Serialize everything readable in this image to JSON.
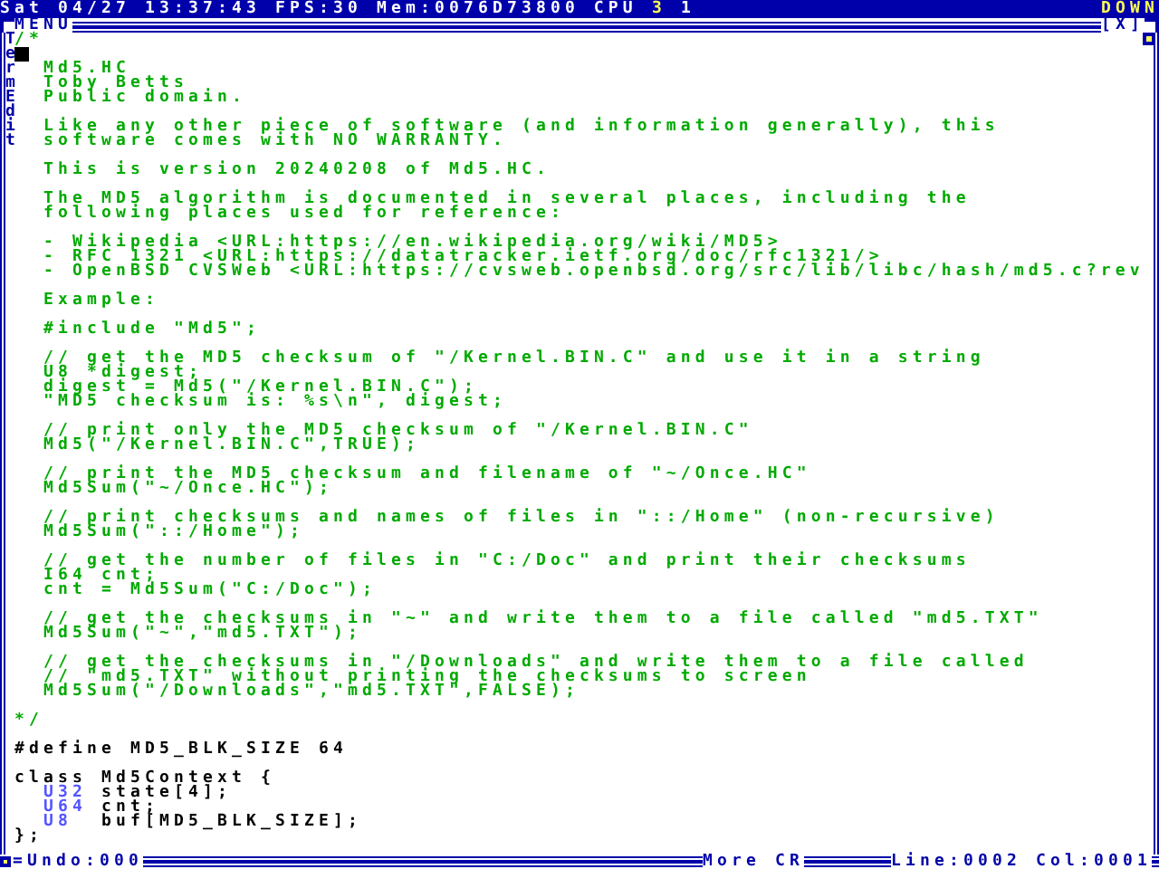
{
  "top_bar": {
    "status": "Sat 04/27 13:37:43 FPS:30 Mem:0076D73800 CPU",
    "cpus": [
      {
        "label": "3",
        "highlighted": true
      },
      {
        "label": "1",
        "highlighted": false
      }
    ],
    "scroll_hint": "DOWN"
  },
  "window": {
    "menu": "MENU",
    "close": "[X]",
    "side_labels": [
      "Term",
      "Edit"
    ],
    "lines": [
      {
        "kind": "comment",
        "segments": [
          {
            "text": "/*",
            "kind": "comment"
          }
        ]
      },
      {
        "kind": "cursor"
      },
      {
        "kind": "text",
        "segments": [
          {
            "text": "  Md5.HC",
            "kind": "comment"
          }
        ]
      },
      {
        "kind": "text",
        "segments": [
          {
            "text": "  Toby Betts",
            "kind": "comment"
          }
        ]
      },
      {
        "kind": "text",
        "segments": [
          {
            "text": "  Public domain.",
            "kind": "comment"
          }
        ]
      },
      {
        "kind": "blank"
      },
      {
        "kind": "text",
        "segments": [
          {
            "text": "  Like any other piece of software (and information generally), this",
            "kind": "comment"
          }
        ]
      },
      {
        "kind": "text",
        "segments": [
          {
            "text": "  software comes with NO WARRANTY.",
            "kind": "comment"
          }
        ]
      },
      {
        "kind": "blank"
      },
      {
        "kind": "text",
        "segments": [
          {
            "text": "  This is version 20240208 of Md5.HC.",
            "kind": "comment"
          }
        ]
      },
      {
        "kind": "blank"
      },
      {
        "kind": "text",
        "segments": [
          {
            "text": "  The MD5 algorithm is documented in several places, including the",
            "kind": "comment"
          }
        ]
      },
      {
        "kind": "text",
        "segments": [
          {
            "text": "  following places used for reference:",
            "kind": "comment"
          }
        ]
      },
      {
        "kind": "blank"
      },
      {
        "kind": "text",
        "segments": [
          {
            "text": "  - Wikipedia <URL:https://en.wikipedia.org/wiki/MD5>",
            "kind": "comment"
          }
        ]
      },
      {
        "kind": "text",
        "segments": [
          {
            "text": "  - RFC 1321 <URL:https://datatracker.ietf.org/doc/rfc1321/>",
            "kind": "comment"
          }
        ]
      },
      {
        "kind": "text",
        "segments": [
          {
            "text": "  - OpenBSD CVSWeb <URL:https://cvsweb.openbsd.org/src/lib/libc/hash/md5.c?rev",
            "kind": "comment"
          }
        ]
      },
      {
        "kind": "blank"
      },
      {
        "kind": "text",
        "segments": [
          {
            "text": "  Example:",
            "kind": "comment"
          }
        ]
      },
      {
        "kind": "blank"
      },
      {
        "kind": "text",
        "segments": [
          {
            "text": "  #include \"Md5\";",
            "kind": "comment"
          }
        ]
      },
      {
        "kind": "blank"
      },
      {
        "kind": "text",
        "segments": [
          {
            "text": "  // get the MD5 checksum of \"/Kernel.BIN.C\" and use it in a string",
            "kind": "comment"
          }
        ]
      },
      {
        "kind": "text",
        "segments": [
          {
            "text": "  U8 *digest;",
            "kind": "comment"
          }
        ]
      },
      {
        "kind": "text",
        "segments": [
          {
            "text": "  digest = Md5(\"/Kernel.BIN.C\");",
            "kind": "comment"
          }
        ]
      },
      {
        "kind": "text",
        "segments": [
          {
            "text": "  \"MD5 checksum is: %s\\n\", digest;",
            "kind": "comment"
          }
        ]
      },
      {
        "kind": "blank"
      },
      {
        "kind": "text",
        "segments": [
          {
            "text": "  // print only the MD5 checksum of \"/Kernel.BIN.C\"",
            "kind": "comment"
          }
        ]
      },
      {
        "kind": "text",
        "segments": [
          {
            "text": "  Md5(\"/Kernel.BIN.C\",TRUE);",
            "kind": "comment"
          }
        ]
      },
      {
        "kind": "blank"
      },
      {
        "kind": "text",
        "segments": [
          {
            "text": "  // print the MD5 checksum and filename of \"~/Once.HC\"",
            "kind": "comment"
          }
        ]
      },
      {
        "kind": "text",
        "segments": [
          {
            "text": "  Md5Sum(\"~/Once.HC\");",
            "kind": "comment"
          }
        ]
      },
      {
        "kind": "blank"
      },
      {
        "kind": "text",
        "segments": [
          {
            "text": "  // print checksums and names of files in \"::/Home\" (non-recursive)",
            "kind": "comment"
          }
        ]
      },
      {
        "kind": "text",
        "segments": [
          {
            "text": "  Md5Sum(\"::/Home\");",
            "kind": "comment"
          }
        ]
      },
      {
        "kind": "blank"
      },
      {
        "kind": "text",
        "segments": [
          {
            "text": "  // get the number of files in \"C:/Doc\" and print their checksums",
            "kind": "comment"
          }
        ]
      },
      {
        "kind": "text",
        "segments": [
          {
            "text": "  I64 cnt;",
            "kind": "comment"
          }
        ]
      },
      {
        "kind": "text",
        "segments": [
          {
            "text": "  cnt = Md5Sum(\"C:/Doc\");",
            "kind": "comment"
          }
        ]
      },
      {
        "kind": "blank"
      },
      {
        "kind": "text",
        "segments": [
          {
            "text": "  // get the checksums in \"~\" and write them to a file called \"md5.TXT\"",
            "kind": "comment"
          }
        ]
      },
      {
        "kind": "text",
        "segments": [
          {
            "text": "  Md5Sum(\"~\",\"md5.TXT\");",
            "kind": "comment"
          }
        ]
      },
      {
        "kind": "blank"
      },
      {
        "kind": "text",
        "segments": [
          {
            "text": "  // get the checksums in \"/Downloads\" and write them to a file called",
            "kind": "comment"
          }
        ]
      },
      {
        "kind": "text",
        "segments": [
          {
            "text": "  // \"md5.TXT\" without printing the checksums to screen",
            "kind": "comment"
          }
        ]
      },
      {
        "kind": "text",
        "segments": [
          {
            "text": "  Md5Sum(\"/Downloads\",\"md5.TXT\",FALSE);",
            "kind": "comment"
          }
        ]
      },
      {
        "kind": "blank"
      },
      {
        "kind": "text",
        "segments": [
          {
            "text": "*/",
            "kind": "comment"
          }
        ]
      },
      {
        "kind": "blank"
      },
      {
        "kind": "text",
        "segments": [
          {
            "text": "#define MD5_BLK_SIZE 64",
            "kind": "code"
          }
        ]
      },
      {
        "kind": "blank"
      },
      {
        "kind": "text",
        "segments": [
          {
            "text": "class Md5Context {",
            "kind": "code"
          }
        ]
      },
      {
        "kind": "text",
        "segments": [
          {
            "text": "  U32",
            "kind": "type"
          },
          {
            "text": " state[4];",
            "kind": "code"
          }
        ]
      },
      {
        "kind": "text",
        "segments": [
          {
            "text": "  U64",
            "kind": "type"
          },
          {
            "text": " cnt;",
            "kind": "code"
          }
        ]
      },
      {
        "kind": "text",
        "segments": [
          {
            "text": "  U8",
            "kind": "type"
          },
          {
            "text": "  buf[MD5_BLK_SIZE];",
            "kind": "code"
          }
        ]
      },
      {
        "kind": "text",
        "segments": [
          {
            "text": "};",
            "kind": "code"
          }
        ]
      }
    ],
    "status": {
      "undo": "=Undo:000",
      "more": "More CR",
      "line": "Line:0002",
      "col": "Col:0001"
    }
  }
}
